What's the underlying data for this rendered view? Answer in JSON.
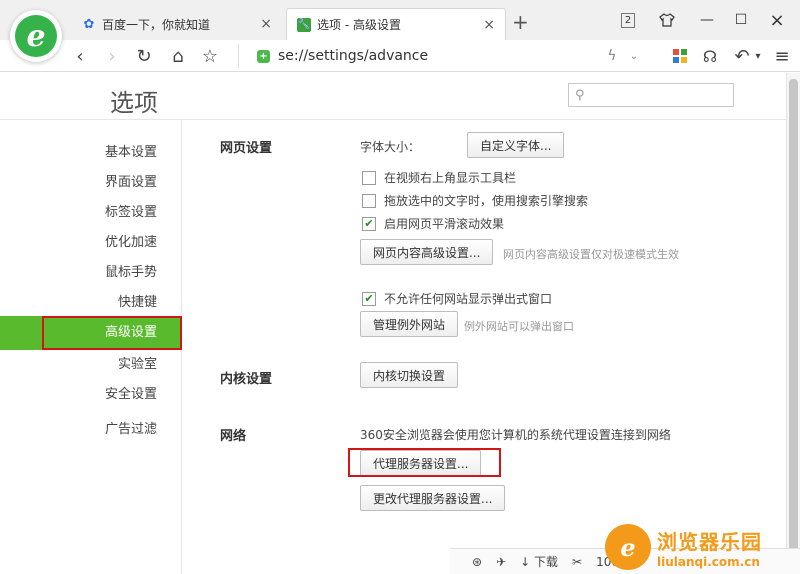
{
  "tabs": [
    {
      "title": "百度一下，你就知道",
      "icon": "baidu-paw-icon"
    },
    {
      "title": "选项 - 高级设置",
      "icon": "wrench-icon"
    }
  ],
  "window": {
    "tab_count": "2"
  },
  "address": {
    "scheme": "se:",
    "path": "//settings/advance"
  },
  "page": {
    "title": "选项"
  },
  "sidebar": {
    "items": [
      {
        "label": "基本设置"
      },
      {
        "label": "界面设置"
      },
      {
        "label": "标签设置"
      },
      {
        "label": "优化加速"
      },
      {
        "label": "鼠标手势"
      },
      {
        "label": "快捷键"
      },
      {
        "label": "高级设置"
      },
      {
        "label": "实验室"
      },
      {
        "label": "安全设置"
      },
      {
        "label": "广告过滤"
      }
    ]
  },
  "web": {
    "section": "网页设置",
    "font_size_label": "字体大小：",
    "custom_font_button": "自定义字体...",
    "checks": [
      {
        "label": "在视频右上角显示工具栏",
        "checked": false
      },
      {
        "label": "拖放选中的文字时，使用搜索引擎搜索",
        "checked": false
      },
      {
        "label": "启用网页平滑滚动效果",
        "checked": true
      }
    ],
    "advanced_button": "网页内容高级设置...",
    "advanced_hint": "网页内容高级设置仅对极速模式生效",
    "popup_check": "不允许任何网站显示弹出式窗口",
    "exceptions_button": "管理例外网站",
    "exceptions_hint": "例外网站可以弹出窗口"
  },
  "kernel": {
    "section": "内核设置",
    "button": "内核切换设置"
  },
  "network": {
    "section": "网络",
    "description": "360安全浏览器会使用您计算机的系统代理设置连接到网络",
    "proxy_button": "代理服务器设置...",
    "change_proxy_button": "更改代理服务器设置..."
  },
  "status": {
    "download": "下载",
    "zoom": "100%"
  },
  "watermark": {
    "main": "浏览器乐园",
    "sub": "liulanqi.com.cn"
  }
}
